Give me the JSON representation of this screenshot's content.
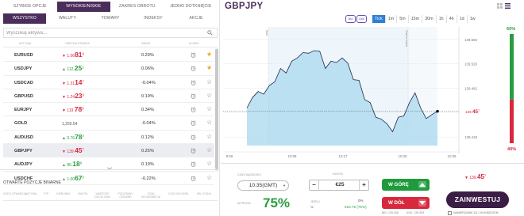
{
  "left": {
    "tabs_top": [
      {
        "label": "SZYBKIE OPCJE",
        "active": false
      },
      {
        "label": "WYSOKIE/NISKIE",
        "active": true
      },
      {
        "label": "ZAKRES OBROTU",
        "active": false
      },
      {
        "label": "JEDNO DOTKNIĘCIE",
        "active": false
      }
    ],
    "tabs_bottom": [
      {
        "label": "WSZYSTKO",
        "active": true
      },
      {
        "label": "WALUTY",
        "active": false
      },
      {
        "label": "TOWARY",
        "active": false
      },
      {
        "label": "INDEKSY",
        "active": false
      },
      {
        "label": "AKCJE",
        "active": false
      }
    ],
    "search_placeholder": "Wyszukaj aktywa...",
    "columns": [
      "AKTYWA",
      "OBECNA STAWKA",
      "ZMIAN",
      "ALARM"
    ],
    "assets": [
      {
        "name": "EURUSD",
        "dir": "dn",
        "arrow": "▼",
        "small": "1.06",
        "big": "81",
        "sup": "8",
        "pct": "0.29%",
        "star": "on",
        "selected": false
      },
      {
        "name": "USDJPY",
        "dir": "up",
        "arrow": "▲",
        "small": "112.",
        "big": "25",
        "sup": "2",
        "pct": "0.06%",
        "star": "on",
        "selected": false
      },
      {
        "name": "USDCAD",
        "dir": "dn",
        "arrow": "▼",
        "small": "1.31",
        "big": "14",
        "sup": "7",
        "pct": "-0.04%",
        "star": "off",
        "selected": false
      },
      {
        "name": "GBPUSD",
        "dir": "dn",
        "arrow": "▼",
        "small": "1.24",
        "big": "23",
        "sup": "9",
        "pct": "0.19%",
        "star": "off",
        "selected": false
      },
      {
        "name": "EURJPY",
        "dir": "dn",
        "arrow": "▼",
        "small": "119.",
        "big": "78",
        "sup": "9",
        "pct": "0.34%",
        "star": "off",
        "selected": false
      },
      {
        "name": "GOLD",
        "dir": "nt",
        "arrow": "",
        "small": "1,255.54",
        "big": "",
        "sup": "",
        "pct": "-0.04%",
        "star": "off",
        "selected": false
      },
      {
        "name": "AUDUSD",
        "dir": "up",
        "arrow": "▲",
        "small": "0.76",
        "big": "78",
        "sup": "0",
        "pct": "0.12%",
        "star": "off",
        "selected": false
      },
      {
        "name": "GBPJPY",
        "dir": "dn",
        "arrow": "▼",
        "small": "139.",
        "big": "45",
        "sup": "7",
        "pct": "0.25%",
        "star": "off",
        "selected": true
      },
      {
        "name": "AUDJPY",
        "dir": "up",
        "arrow": "▲",
        "small": "86.",
        "big": "18",
        "sup": "8",
        "pct": "0.19%",
        "star": "off",
        "selected": false
      },
      {
        "name": "USDCHF",
        "dir": "up",
        "arrow": "▲",
        "small": "1.00",
        "big": "67",
        "sup": "0",
        "pct": "-0.22%",
        "star": "off",
        "selected": false
      }
    ],
    "open_positions_title": "OTWARTE POZYCJE BINARNE",
    "open_columns": [
      "GODZ.OTWARCIA",
      "AKTYWA",
      "TYP",
      "KIERUNEK",
      "KWOTA",
      "WARTOŚĆ DOCELOWA",
      "PODSTAWY CENOWE",
      "STAN WYGASNIĘCIA",
      "CZAS WYGAŚN.",
      "ZW. ZYSKU"
    ]
  },
  "chart": {
    "pair": "GBPJPY",
    "toggles": [
      "Bid",
      "Ask"
    ],
    "timeframes": [
      {
        "label": "Tick",
        "active": true
      },
      {
        "label": "1m",
        "active": false
      },
      {
        "label": "5m",
        "active": false
      },
      {
        "label": "15m",
        "active": false
      },
      {
        "label": "30m",
        "active": false
      },
      {
        "label": "1h",
        "active": false
      },
      {
        "label": "4h",
        "active": false
      },
      {
        "label": "1d",
        "active": false
      },
      {
        "label": "1w",
        "active": false
      }
    ],
    "marker_start": "Start",
    "marker_end": "Time to invest",
    "current_price": "139.457",
    "current_small": "139.",
    "current_big": "45",
    "current_sup": "7",
    "sentiment_up": "60%",
    "sentiment_down": "40%",
    "sentiment_up_value": 0.6,
    "colors": {
      "line": "#1b2a48",
      "fill": "#a9d8ef",
      "up": "#2a9d3f",
      "down": "#d8283e",
      "accent": "#4b2d5c"
    }
  },
  "chart_data": {
    "type": "line",
    "x_tick_labels": [
      "9:59",
      "10:08",
      "10:17",
      "10:26",
      "10:35"
    ],
    "y_tick_labels": [
      "139.566",
      "139.529",
      "139.492",
      "139.455",
      "139.418"
    ],
    "ylim": [
      139.405,
      139.585
    ],
    "x": [
      0,
      8,
      16,
      24,
      32,
      40,
      48,
      56,
      64,
      72,
      80,
      88,
      96,
      104,
      112,
      120,
      128,
      136,
      144,
      152,
      160,
      168,
      176,
      184,
      192,
      200,
      208,
      216,
      224,
      232,
      240,
      248,
      256,
      264,
      272
    ],
    "values": [
      139.462,
      139.478,
      139.487,
      139.483,
      139.496,
      139.502,
      139.522,
      139.515,
      139.533,
      139.538,
      139.546,
      139.545,
      139.549,
      139.548,
      139.522,
      139.533,
      139.531,
      139.538,
      139.53,
      139.505,
      139.504,
      139.475,
      139.47,
      139.448,
      139.445,
      139.438,
      139.426,
      139.448,
      139.45,
      139.47,
      139.485,
      139.462,
      139.446,
      139.452,
      139.457
    ],
    "current": 139.457
  },
  "trade": {
    "expiry_label": "CZAS WAŻNOŚCI",
    "expiry_value": "10:35(GMT)",
    "payout_label": "WYPŁATA",
    "payout_value": "75%",
    "amount_label": "KWOTA",
    "amount_value": "€25",
    "minus": "−",
    "plus": "+",
    "if_label": "JEŻELI",
    "zero": "0%",
    "profit": "€18.75 (75%)",
    "pct_sym": "%",
    "up_label": "W GÓRĘ",
    "down_label": "W DÓŁ",
    "bid_text": "BID: 139.456",
    "ask_text": "ASK: 139.459",
    "price_small": "139.",
    "price_big": "45",
    "price_sup": "7",
    "invest_label": "ZAINWESTUJ",
    "checkbox_label": "NAMIERZANIE ZA 1 KLIKNIĘCIEM"
  }
}
